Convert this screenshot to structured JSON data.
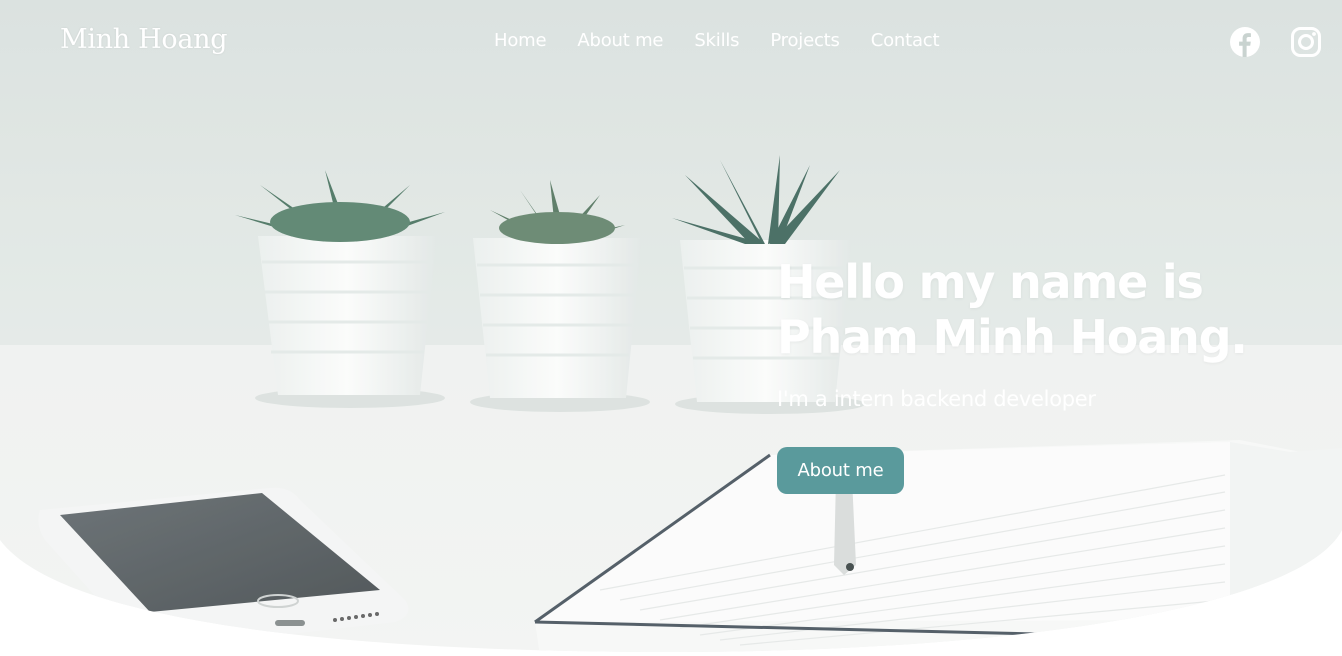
{
  "brand": {
    "name": "Minh Hoang"
  },
  "nav": {
    "items": [
      {
        "label": "Home"
      },
      {
        "label": "About me"
      },
      {
        "label": "Skills"
      },
      {
        "label": "Projects"
      },
      {
        "label": "Contact"
      }
    ]
  },
  "social": [
    {
      "icon": "facebook-icon"
    },
    {
      "icon": "instagram-icon"
    }
  ],
  "hero": {
    "headline_line1": "Hello my name is",
    "headline_line2": "Pham Minh Hoang.",
    "subtitle": "I'm a intern backend developer",
    "button_label": "About me"
  },
  "colors": {
    "accent": "#5a9a9c",
    "text": "#ffffff",
    "background": "#ffffff"
  }
}
